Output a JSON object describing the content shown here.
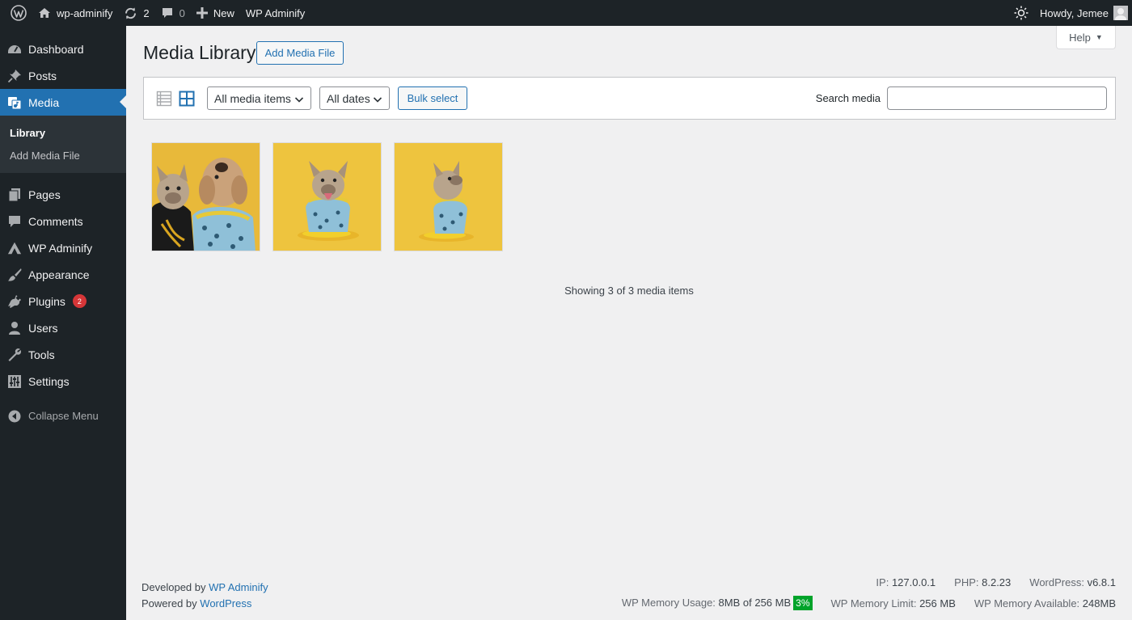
{
  "admin_bar": {
    "site_name": "wp-adminify",
    "updates_count": "2",
    "comments_count": "0",
    "new_label": "New",
    "plugin_link": "WP Adminify",
    "greeting": "Howdy, Jemee"
  },
  "sidebar": {
    "items": [
      {
        "label": "Dashboard",
        "icon": "dashboard-icon"
      },
      {
        "label": "Posts",
        "icon": "pin-icon"
      },
      {
        "label": "Media",
        "icon": "media-icon",
        "active": true
      },
      {
        "label": "Pages",
        "icon": "pages-icon"
      },
      {
        "label": "Comments",
        "icon": "comment-icon"
      },
      {
        "label": "WP Adminify",
        "icon": "adminify-icon"
      },
      {
        "label": "Appearance",
        "icon": "brush-icon"
      },
      {
        "label": "Plugins",
        "icon": "plugin-icon",
        "badge": "2"
      },
      {
        "label": "Users",
        "icon": "user-icon"
      },
      {
        "label": "Tools",
        "icon": "wrench-icon"
      },
      {
        "label": "Settings",
        "icon": "settings-icon"
      }
    ],
    "submenu": [
      "Library",
      "Add Media File"
    ],
    "collapse_label": "Collapse Menu"
  },
  "main": {
    "title": "Media Library",
    "add_button": "Add Media File",
    "help_label": "Help",
    "toolbar": {
      "type_filter": "All media items",
      "date_filter": "All dates",
      "bulk_select": "Bulk select",
      "search_label": "Search media",
      "search_value": ""
    },
    "thumbnails": [
      {
        "alt": "Two dogs on yellow background",
        "icon": "image-two-dogs"
      },
      {
        "alt": "French bulldog sitting, looking up",
        "icon": "image-bulldog-front"
      },
      {
        "alt": "French bulldog sitting, side view",
        "icon": "image-bulldog-side"
      }
    ],
    "showing_text": "Showing 3 of 3 media items"
  },
  "footer": {
    "developed_by": "Developed by",
    "developed_link": "WP Adminify",
    "powered_by": "Powered by",
    "powered_link": "WordPress",
    "ip_label": "IP:",
    "ip_value": "127.0.0.1",
    "php_label": "PHP:",
    "php_value": "8.2.23",
    "wp_label": "WordPress:",
    "wp_value": "v6.8.1",
    "mem_usage_label": "WP Memory Usage:",
    "mem_usage_value": "8MB of 256 MB",
    "mem_usage_pct": "3%",
    "mem_limit_label": "WP Memory Limit:",
    "mem_limit_value": "256 MB",
    "mem_avail_label": "WP Memory Available:",
    "mem_avail_value": "248MB"
  },
  "colors": {
    "admin_dark": "#1d2327",
    "accent_blue": "#2271b1",
    "content_bg": "#f0f0f1",
    "badge_red": "#d63638",
    "success_green": "#00a32a",
    "thumb_yellow": "#e8b93a"
  }
}
